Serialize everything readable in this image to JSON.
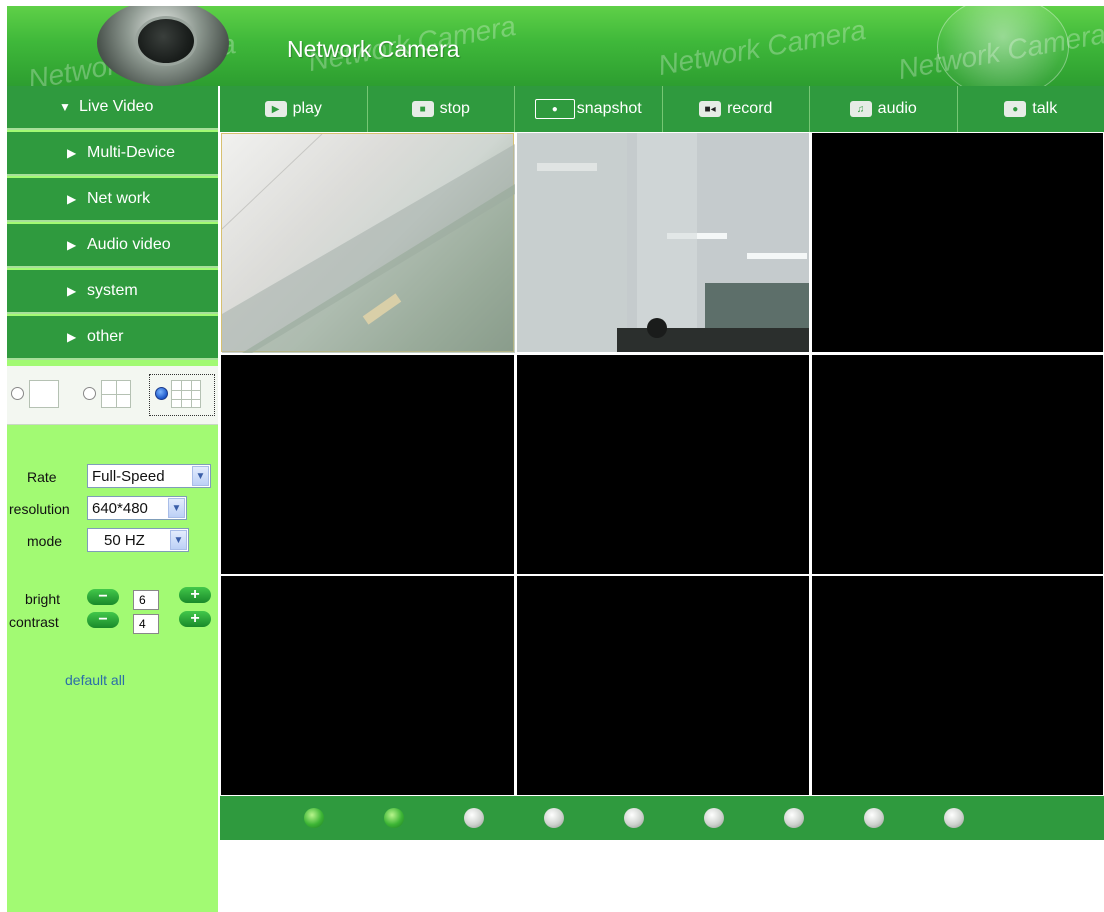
{
  "header": {
    "title": "Network Camera",
    "watermark": "Network Camera"
  },
  "menu": [
    {
      "label": "Live Video",
      "icon": "triangle-down"
    },
    {
      "label": "Multi-Device",
      "icon": "triangle-right"
    },
    {
      "label": "Net work",
      "icon": "triangle-right"
    },
    {
      "label": "Audio video",
      "icon": "triangle-right"
    },
    {
      "label": "system",
      "icon": "triangle-right"
    },
    {
      "label": "other",
      "icon": "triangle-right"
    }
  ],
  "layout_options": {
    "selected": "9-split",
    "options": [
      "1-split",
      "4-split",
      "9-split"
    ]
  },
  "controls": {
    "rate_label": "Rate",
    "rate_value": "Full-Speed",
    "resolution_label": "resolution",
    "resolution_value": "640*480",
    "mode_label": "mode",
    "mode_value": "50 HZ",
    "bright_label": "bright",
    "bright_value": "6",
    "contrast_label": "contrast",
    "contrast_value": "4",
    "default_link": "default all"
  },
  "toolbar": {
    "play": "play",
    "stop": "stop",
    "snapshot": "snapshot",
    "record": "record",
    "audio": "audio",
    "talk": "talk"
  },
  "channels": [
    {
      "active": true
    },
    {
      "active": true
    },
    {
      "active": false
    },
    {
      "active": false
    },
    {
      "active": false
    },
    {
      "active": false
    },
    {
      "active": false
    },
    {
      "active": false
    },
    {
      "active": false
    }
  ],
  "colors": {
    "menu_green": "#2f9a3e",
    "sidebar_green": "#a2fa73",
    "header_green": "#3fb83a"
  }
}
